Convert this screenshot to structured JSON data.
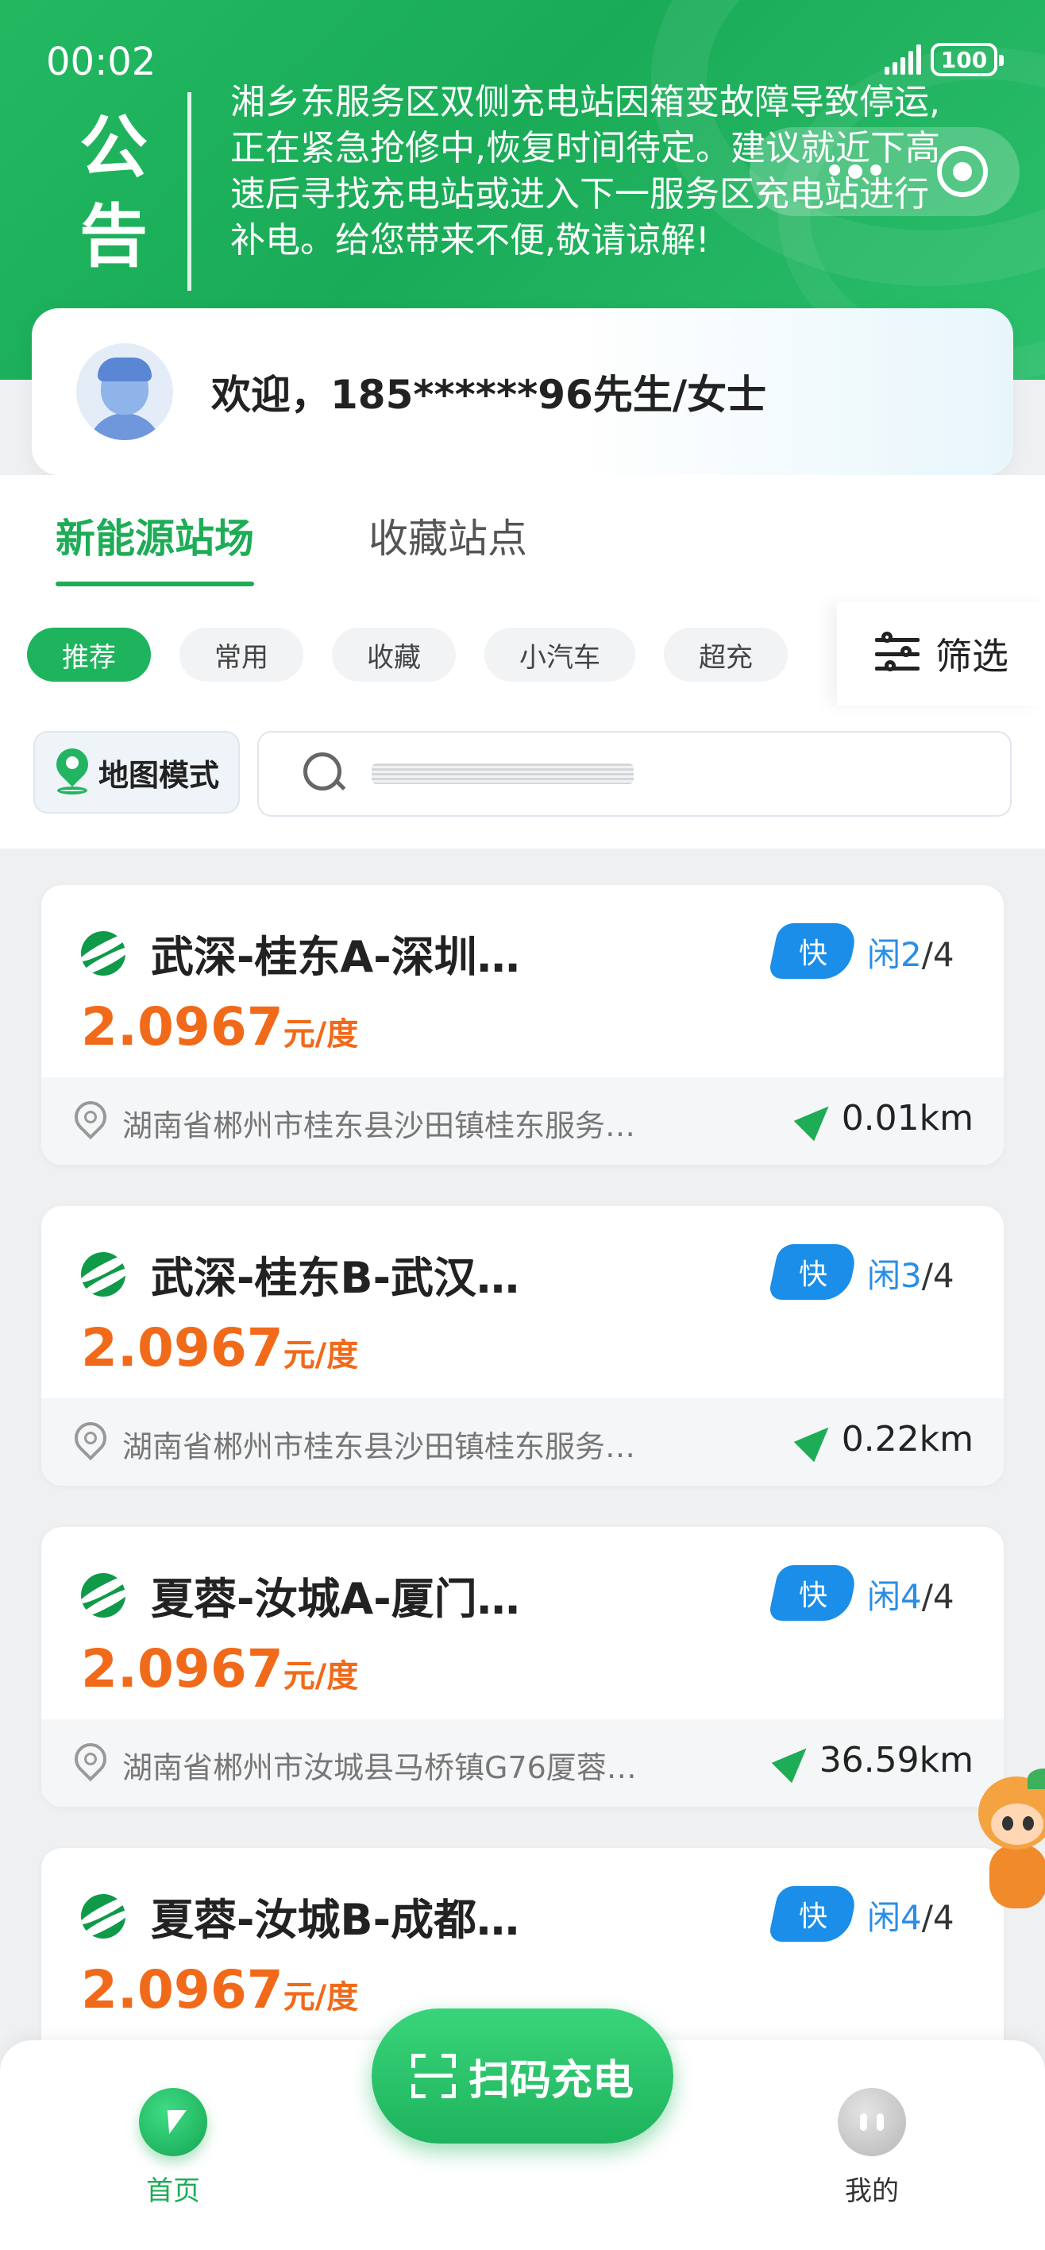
{
  "status": {
    "time": "00:02",
    "battery": "100"
  },
  "notice": {
    "label_1": "公",
    "label_2": "告",
    "text": "湘乡东服务区双侧充电站因箱变故障导致停运,正在紧急抢修中,恢复时间待定。建议就近下高速后寻找充电站或进入下一服务区充电站进行补电。给您带来不便,敬请谅解!"
  },
  "welcome": {
    "text": "欢迎，185******96先生/女士"
  },
  "tabs": [
    "新能源站场",
    "收藏站点"
  ],
  "chips": [
    "推荐",
    "常用",
    "收藏",
    "小汽车",
    "超充"
  ],
  "filter_label": "筛选",
  "map_mode_label": "地图模式",
  "stations": [
    {
      "name": "武深-桂东A-深圳…",
      "badge": "快",
      "idle_label": "闲",
      "idle_free": "2",
      "idle_total": "/4",
      "price": "2.0967",
      "unit": "元/度",
      "address": "湖南省郴州市桂东县沙田镇桂东服务…",
      "distance": "0.01km"
    },
    {
      "name": "武深-桂东B-武汉…",
      "badge": "快",
      "idle_label": "闲",
      "idle_free": "3",
      "idle_total": "/4",
      "price": "2.0967",
      "unit": "元/度",
      "address": "湖南省郴州市桂东县沙田镇桂东服务…",
      "distance": "0.22km"
    },
    {
      "name": "夏蓉-汝城A-厦门…",
      "badge": "快",
      "idle_label": "闲",
      "idle_free": "4",
      "idle_total": "/4",
      "price": "2.0967",
      "unit": "元/度",
      "address": "湖南省郴州市汝城县马桥镇G76厦蓉…",
      "distance": "36.59km"
    },
    {
      "name": "夏蓉-汝城B-成都…",
      "badge": "快",
      "idle_label": "闲",
      "idle_free": "4",
      "idle_total": "/4",
      "price": "2.0967",
      "unit": "元/度",
      "address": "",
      "distance": ""
    }
  ],
  "scan_button": "扫码充电",
  "nav": {
    "home": "首页",
    "mine": "我的"
  },
  "colors": {
    "brand_green": "#1eac57",
    "price_orange": "#f06a1a",
    "badge_blue": "#1a8ee8"
  }
}
